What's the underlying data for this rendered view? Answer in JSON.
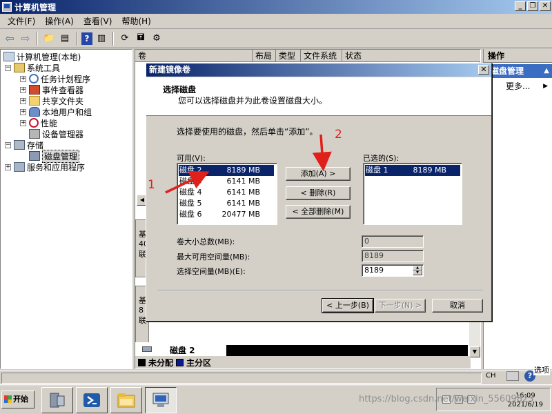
{
  "window": {
    "title": "计算机管理",
    "buttons": [
      "_",
      "❐",
      "✕"
    ]
  },
  "menu": [
    "文件(F)",
    "操作(A)",
    "查看(V)",
    "帮助(H)"
  ],
  "tree": {
    "root": "计算机管理(本地)",
    "system_tools": "系统工具",
    "task_scheduler": "任务计划程序",
    "event_viewer": "事件查看器",
    "shared_folders": "共享文件夹",
    "local_users": "本地用户和组",
    "performance": "性能",
    "device_manager": "设备管理器",
    "storage": "存储",
    "disk_management": "磁盘管理",
    "services": "服务和应用程序"
  },
  "center": {
    "columns": [
      "卷",
      "布局",
      "类型",
      "文件系统",
      "状态"
    ],
    "disk2_label": "磁盘 2",
    "stub_labels": [
      "基",
      "40",
      "联",
      "基",
      "8",
      "联"
    ],
    "legend": {
      "unallocated": "未分配",
      "primary": "主分区"
    },
    "colors": {
      "unallocated": "#000000",
      "primary": "#0b1a8f"
    }
  },
  "actions": {
    "header": "操作",
    "section": "磁盘管理",
    "more": "更多..."
  },
  "dialog": {
    "title": "新建镜像卷",
    "heading": "选择磁盘",
    "subheading": "您可以选择磁盘并为此卷设置磁盘大小。",
    "instruction": "选择要使用的磁盘，然后单击“添加”。",
    "available_label": "可用(V):",
    "selected_label": "已选的(S):",
    "available_disks": [
      {
        "name": "磁盘 2",
        "size": "8189 MB"
      },
      {
        "name": "磁盘 3",
        "size": "6141 MB"
      },
      {
        "name": "磁盘 4",
        "size": "6141 MB"
      },
      {
        "name": "磁盘 5",
        "size": "6141 MB"
      },
      {
        "name": "磁盘 6",
        "size": "20477 MB"
      }
    ],
    "selected_disks": [
      {
        "name": "磁盘 1",
        "size": "8189 MB"
      }
    ],
    "add_button": "添加(A) >",
    "remove_button": "< 删除(R)",
    "remove_all_button": "< 全部删除(M)",
    "total_size_label": "卷大小总数(MB):",
    "total_size_value": "0",
    "max_space_label": "最大可用空间量(MB):",
    "max_space_value": "8189",
    "select_space_label": "选择空间量(MB)(E):",
    "select_space_value": "8189",
    "back_button": "< 上一步(B)",
    "next_button": "下一步(N) >",
    "cancel_button": "取消"
  },
  "annotations": {
    "one": "1",
    "two": "2",
    "color": "#e0201a"
  },
  "language_bar": {
    "lang": "CH",
    "options": "选项"
  },
  "taskbar": {
    "start": "开始",
    "time": "16:09",
    "date": "2021/6/19",
    "watermark": "https://blog.csdn.net/weixin_55609823"
  }
}
